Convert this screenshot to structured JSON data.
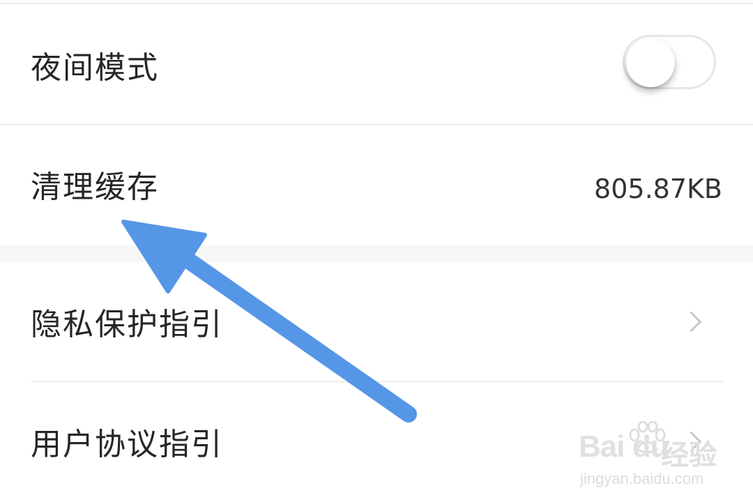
{
  "settings": {
    "night_mode": {
      "label": "夜间模式",
      "enabled": false
    },
    "clear_cache": {
      "label": "清理缓存",
      "value": "805.87KB"
    },
    "privacy_guide": {
      "label": "隐私保护指引"
    },
    "user_agreement": {
      "label": "用户协议指引"
    }
  },
  "overlay": {
    "arrow_color": "#5596e6"
  },
  "watermark": {
    "logo_text": "Bai du",
    "cn_text": "经验",
    "url": "jingyan.baidu.com"
  },
  "colors": {
    "background": "#ffffff",
    "section_gap": "#f7f7f7",
    "divider": "#e3e3e3",
    "text": "#262626",
    "chevron": "#c7c7c7"
  }
}
